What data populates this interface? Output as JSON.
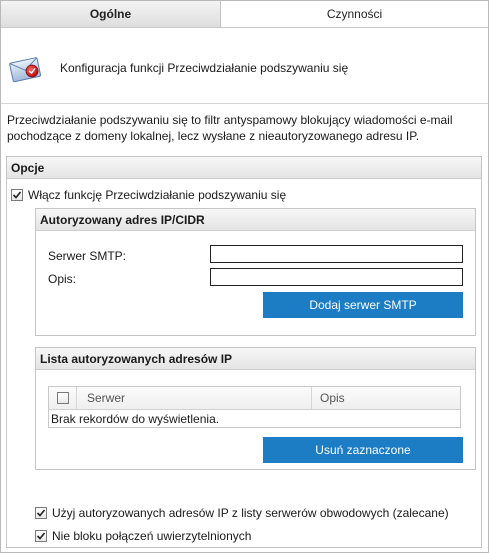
{
  "tabs": [
    {
      "label": "Ogólne",
      "active": true
    },
    {
      "label": "Czynności",
      "active": false
    }
  ],
  "header": {
    "icon": "envelope-shield-icon",
    "title": "Konfiguracja funkcji Przeciwdziałanie podszywaniu się"
  },
  "description": "Przeciwdziałanie podszywaniu się to filtr antyspamowy blokujący wiadomości e-mail pochodzące z domeny lokalnej, lecz wysłane z nieautoryzowanego adresu IP.",
  "options": {
    "title": "Opcje",
    "enable_checkbox": {
      "label": "Włącz funkcję Przeciwdziałanie podszywaniu się",
      "checked": true
    },
    "authorized_panel": {
      "title": "Autoryzowany adres IP/CIDR",
      "smtp_label": "Serwer SMTP:",
      "smtp_value": "",
      "desc_label": "Opis:",
      "desc_value": "",
      "add_button": "Dodaj serwer SMTP"
    },
    "list_panel": {
      "title": "Lista autoryzowanych adresów IP",
      "columns": [
        "Serwer",
        "Opis"
      ],
      "select_all_checked": false,
      "rows": [],
      "empty_text": "Brak rekordów do wyświetlenia.",
      "remove_button": "Usuń zaznaczone"
    },
    "use_perimeter_checkbox": {
      "label": "Użyj autoryzowanych adresów IP z listy serwerów obwodowych (zalecane)",
      "checked": true
    },
    "no_block_checkbox": {
      "label": "Nie bloku połączeń uwierzytelnionych",
      "checked": true
    }
  },
  "colors": {
    "button_bg": "#1c7cc4",
    "button_text": "#ffffff",
    "header_gradient_top": "#f7f7f7",
    "header_gradient_bottom": "#e4e4e4",
    "border": "#c5c5c5"
  }
}
